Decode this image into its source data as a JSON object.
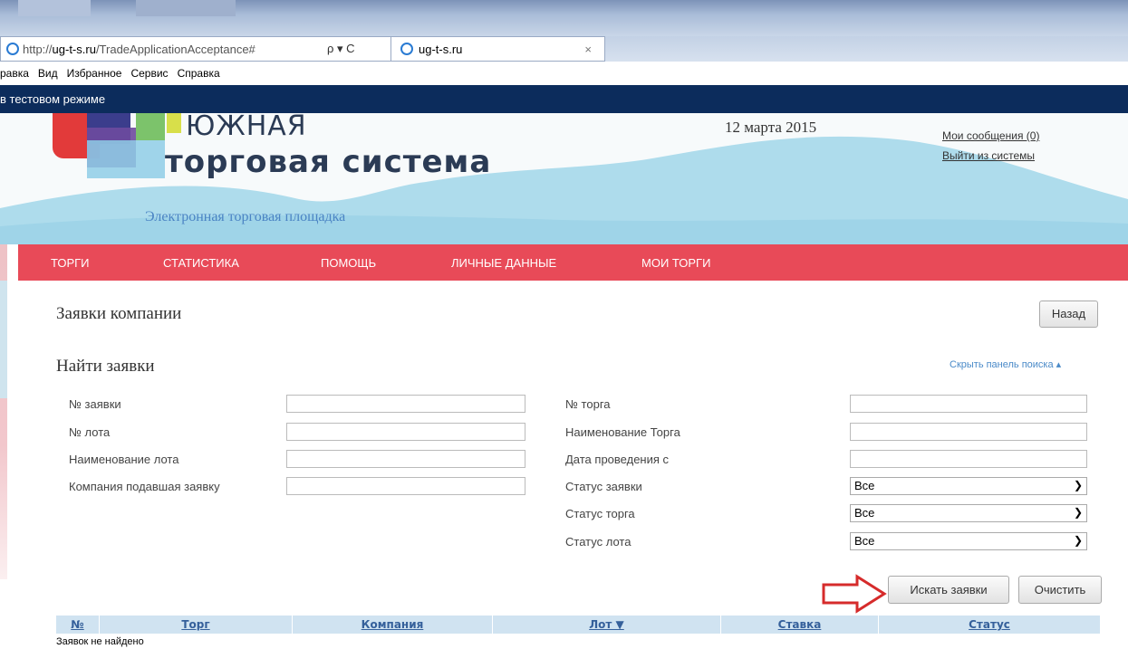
{
  "browser": {
    "url_prefix": "http://",
    "url_host": "ug-t-s.ru",
    "url_path": "/TradeApplicationAcceptance#",
    "search_ctl": "ρ ▾ C",
    "tab_title": "ug-t-s.ru",
    "tab_close": "×",
    "menu": [
      "равка",
      "Вид",
      "Избранное",
      "Сервис",
      "Справка"
    ]
  },
  "test_banner": "в тестовом режиме",
  "header": {
    "brand_line1": "ЮЖНАЯ",
    "brand_line2": "торговая система",
    "tagline": "Электронная торговая площадка",
    "date": "12 марта 2015",
    "links": {
      "messages": "Мои сообщения (0)",
      "logout": "Выйти из системы"
    }
  },
  "nav": [
    "ТОРГИ",
    "СТАТИСТИКА",
    "ПОМОЩЬ",
    "ЛИЧНЫЕ ДАННЫЕ",
    "МОИ ТОРГИ"
  ],
  "page": {
    "title": "Заявки компании",
    "back_label": "Назад",
    "search_title": "Найти заявки",
    "hide_panel": "Скрыть панель поиска ▴"
  },
  "form": {
    "left": [
      "№ заявки",
      "№ лота",
      "Наименование лота",
      "Компания подавшая заявку"
    ],
    "right_inputs": [
      "№ торга",
      "Наименование Торга",
      "Дата проведения с"
    ],
    "right_selects": [
      {
        "label": "Статус заявки",
        "value": "Все"
      },
      {
        "label": "Статус торга",
        "value": "Все"
      },
      {
        "label": "Статус лота",
        "value": "Все"
      }
    ],
    "search_label": "Искать заявки",
    "clear_label": "Очистить"
  },
  "table": {
    "columns": [
      "№",
      "Торг",
      "Компания",
      "Лот ▼",
      "Ставка",
      "Статус"
    ],
    "empty_text": "Заявок не найдено"
  },
  "colors": {
    "nav": "#e84a58",
    "banner": "#0c2c5c",
    "table_head": "#d0e3f1",
    "arrow": "#d62b2b"
  }
}
